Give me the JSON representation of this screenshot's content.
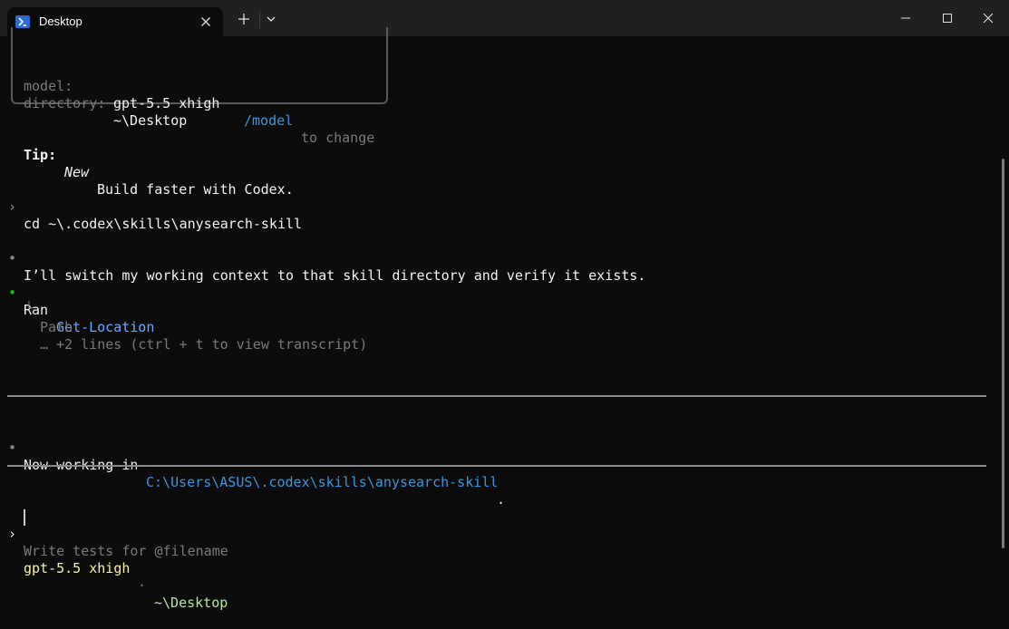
{
  "window": {
    "tab_title": "Desktop",
    "new_tab_symbol": "+",
    "icons": {
      "tab": "powershell-icon",
      "close_tab": "close-icon",
      "new_tab": "plus-icon",
      "dropdown": "chevron-down-icon",
      "minimize": "minimize-icon",
      "maximize": "maximize-icon",
      "close": "close-window-icon"
    }
  },
  "info": {
    "model_label": "model:",
    "model_value": "gpt-5.5 xhigh",
    "model_cmd": "/model",
    "model_hint": "to change",
    "dir_label": "directory:",
    "dir_value": "~\\Desktop"
  },
  "tip": {
    "label": "Tip:",
    "new": "New",
    "text": "Build faster with Codex."
  },
  "history": {
    "prompt_symbol": "›",
    "user_cmd": "cd ~\\.codex\\skills\\anysearch-skill",
    "bullet": "•",
    "assistant_msg": "I’ll switch my working context to that skill directory and verify it exists.",
    "ran_label": "Ran",
    "ran_cmd": "Get-Location",
    "tree_glyph": "└",
    "output_line1": "Path",
    "output_line2": "… +2 lines (ctrl + t to view transcript)",
    "final_prefix": "Now working in",
    "final_path": "C:\\Users\\ASUS\\.codex\\skills\\anysearch-skill",
    "final_suffix": "."
  },
  "composer": {
    "prompt_symbol": "›",
    "placeholder": "Write tests for @filename"
  },
  "status": {
    "model": "gpt-5.5 xhigh",
    "separator": "·",
    "dir": "~\\Desktop"
  },
  "colors": {
    "background": "#0c0c0c",
    "titlebar": "#202020",
    "accent_cyan": "#3a96dd",
    "command_blue": "#6fa8ff",
    "bullet_green": "#16c60c",
    "status_yellow": "#f9f1a5",
    "status_green": "#b5e7a0"
  }
}
